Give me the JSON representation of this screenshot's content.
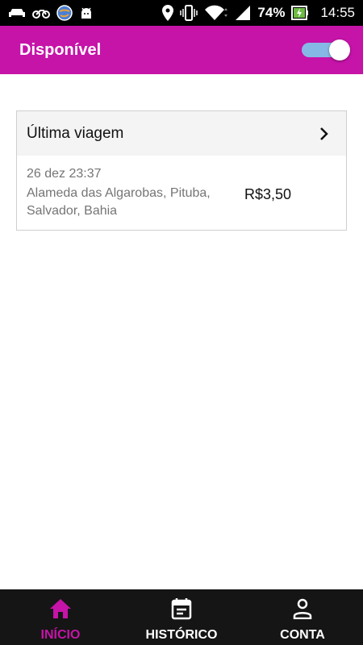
{
  "status_bar": {
    "battery_percent": "74%",
    "time": "14:55",
    "icons": [
      "car-icon",
      "motorcycle-icon",
      "app-globe-icon",
      "android-icon",
      "location-icon",
      "vibrate-icon",
      "wifi-icon",
      "signal-icon",
      "battery-charging-icon"
    ]
  },
  "app_bar": {
    "title": "Disponível",
    "availability_toggle_on": true
  },
  "last_trip": {
    "header": "Última viagem",
    "date": "26 dez 23:37",
    "address": "Alameda das Algarobas, Pituba, Salvador, Bahia",
    "price": "R$3,50"
  },
  "bottom_nav": {
    "items": [
      {
        "label": "INÍCIO",
        "icon": "home-icon",
        "active": true
      },
      {
        "label": "HISTÓRICO",
        "icon": "calendar-icon",
        "active": false
      },
      {
        "label": "CONTA",
        "icon": "person-icon",
        "active": false
      }
    ]
  },
  "colors": {
    "accent": "#c613a8",
    "toggle_track": "#86b8e6",
    "nav_background": "#151515"
  }
}
